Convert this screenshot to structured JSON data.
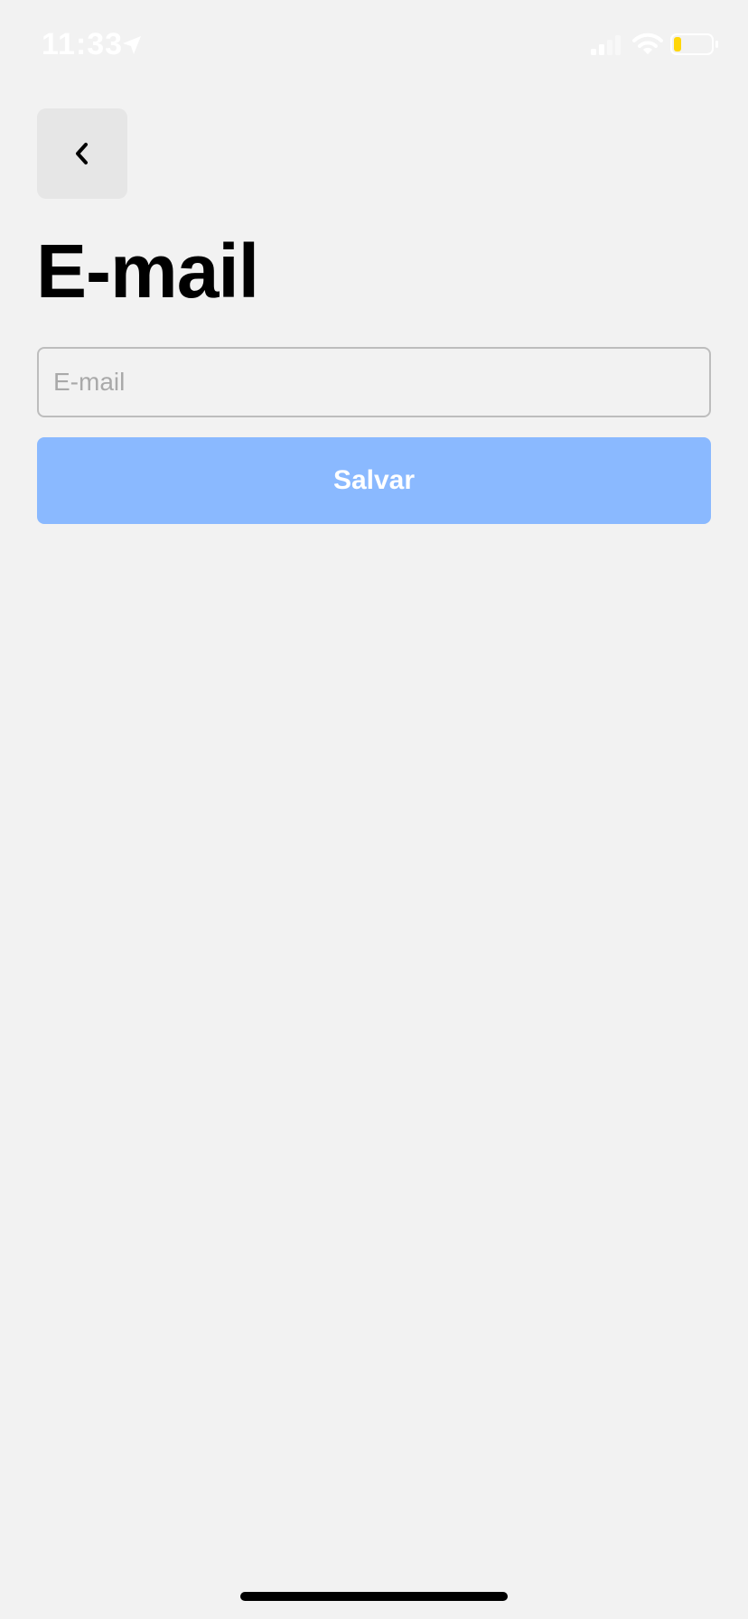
{
  "status_bar": {
    "time": "11:33",
    "icons": [
      "location-arrow-icon",
      "cellular-signal-icon",
      "wifi-icon",
      "battery-icon"
    ],
    "battery_level": 0.2,
    "battery_color": "#ffd60a"
  },
  "header": {
    "back_icon": "chevron-left-icon",
    "title": "E-mail"
  },
  "form": {
    "email_placeholder": "E-mail",
    "email_value": "",
    "save_label": "Salvar"
  },
  "colors": {
    "background": "#f2f2f2",
    "button_bg": "#e6e6e6",
    "primary_disabled": "#8ab9ff",
    "input_border": "#bdbdbd",
    "placeholder": "#a9a9a9"
  }
}
